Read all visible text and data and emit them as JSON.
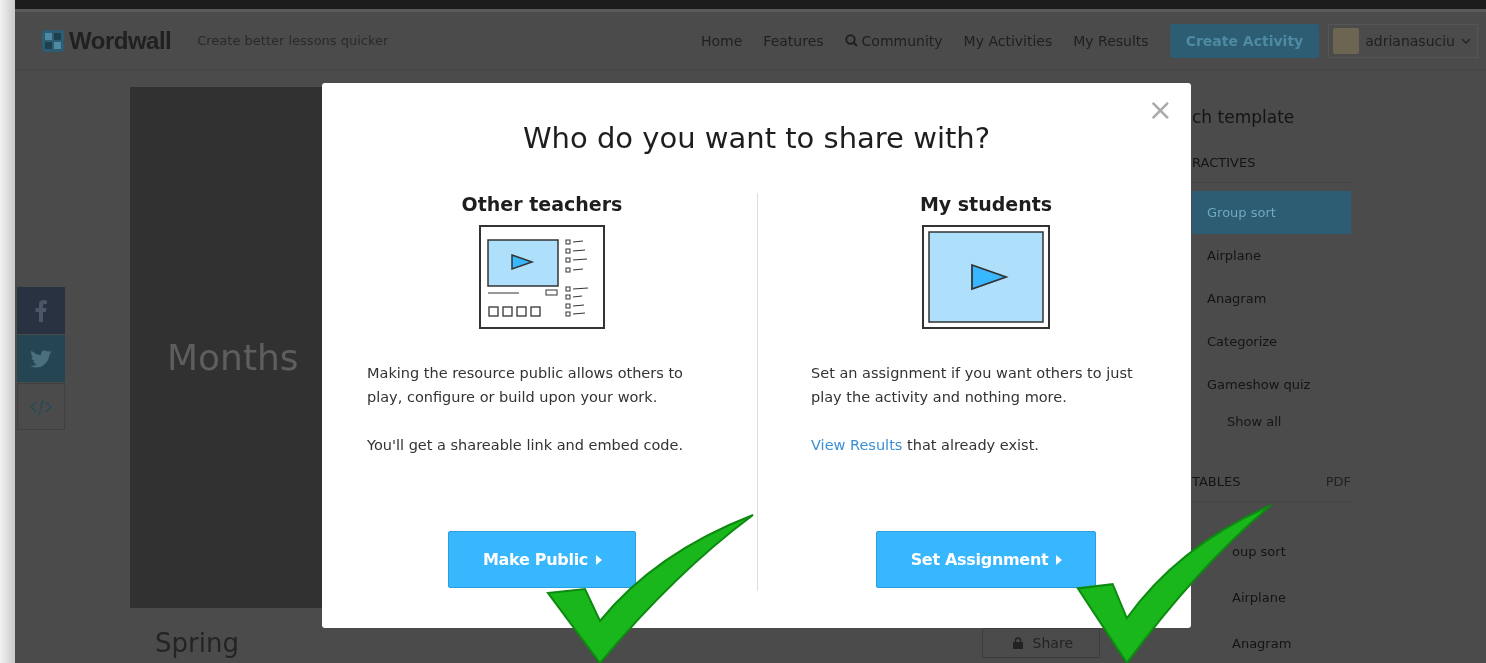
{
  "header": {
    "logo": "Wordwall",
    "tagline": "Create better lessons quicker",
    "nav": [
      {
        "label": "Home",
        "kind": "link"
      },
      {
        "label": "Features",
        "kind": "link"
      },
      {
        "label": "Community",
        "kind": "search"
      },
      {
        "label": "My Activities",
        "kind": "link"
      },
      {
        "label": "My Results",
        "kind": "link"
      }
    ],
    "create_button": "Create Activity",
    "user": {
      "name": "adrianasuciu"
    }
  },
  "activity": {
    "title": "Months",
    "name": "Spring",
    "share_button": "Share"
  },
  "templates": {
    "heading": "ch template",
    "section": "RACTIVES",
    "items": [
      {
        "label": "Group sort",
        "selected": true
      },
      {
        "label": "Airplane",
        "selected": false
      },
      {
        "label": "Anagram",
        "selected": false
      },
      {
        "label": "Categorize",
        "selected": false
      },
      {
        "label": "Gameshow quiz",
        "selected": false
      }
    ],
    "show_all": "Show all",
    "tabs": [
      {
        "label": "TABLES",
        "selected": true
      },
      {
        "label": "PDF",
        "selected": false
      }
    ],
    "printables": [
      {
        "label": "oup sort"
      },
      {
        "label": "Airplane"
      },
      {
        "label": "Anagram"
      }
    ]
  },
  "modal": {
    "title": "Who do you want to share with?",
    "close": "×",
    "options": [
      {
        "heading": "Other teachers",
        "kind": "detailed",
        "paragraphs": [
          {
            "text": "Making the resource public allows others to play, configure or build upon your work."
          },
          {
            "text": "You'll get a shareable link and embed code."
          }
        ],
        "button": "Make Public"
      },
      {
        "heading": "My students",
        "kind": "simple",
        "paragraphs": [
          {
            "text": "Set an assignment if you want others to just play the activity and nothing more."
          },
          {
            "link": "View Results",
            "text": "that already exist."
          }
        ],
        "button": "Set Assignment"
      }
    ]
  }
}
